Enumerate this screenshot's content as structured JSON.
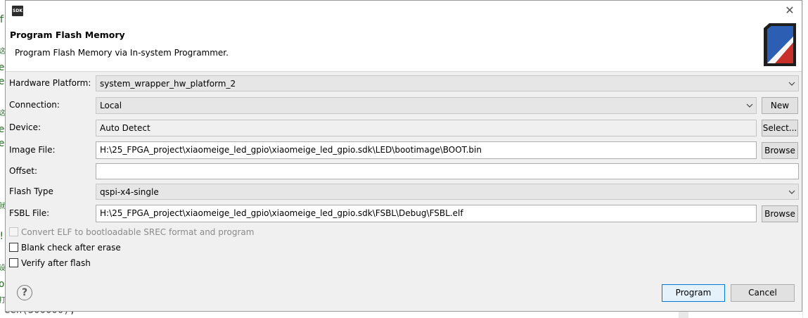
{
  "window": {
    "app_icon_text": "SDK",
    "close_glyph": "✕"
  },
  "header": {
    "title": "Program Flash Memory",
    "description": "Program Flash Memory via In-system Programmer.",
    "icon": "flash-memory-card-icon"
  },
  "form": {
    "hardware_platform": {
      "label": "Hardware Platform:",
      "value": "system_wrapper_hw_platform_2"
    },
    "connection": {
      "label": "Connection:",
      "value": "Local",
      "new_button": "New"
    },
    "device": {
      "label": "Device:",
      "value": "Auto Detect",
      "select_button": "Select..."
    },
    "image_file": {
      "label": "Image File:",
      "value": "H:\\25_FPGA_project\\xiaomeige_led_gpio\\xiaomeige_led_gpio.sdk\\LED\\bootimage\\BOOT.bin",
      "browse_button": "Browse"
    },
    "offset": {
      "label": "Offset:",
      "value": ""
    },
    "flash_type": {
      "label": "Flash Type",
      "value": "qspi-x4-single"
    },
    "fsbl_file": {
      "label": "FSBL File:",
      "value": "H:\\25_FPGA_project\\xiaomeige_led_gpio\\xiaomeige_led_gpio.sdk\\FSBL\\Debug\\FSBL.elf",
      "browse_button": "Browse"
    }
  },
  "options": {
    "convert_elf": {
      "label": "Convert ELF to bootloadable SREC format and program",
      "checked": false,
      "enabled": false
    },
    "blank_check": {
      "label": "Blank check after erase",
      "checked": false
    },
    "verify": {
      "label": "Verify after flash",
      "checked": false
    }
  },
  "footer": {
    "help_glyph": "?",
    "program_button": "Program",
    "cancel_button": "Cancel"
  },
  "background": {
    "left_gutter": [
      "f",
      "这",
      "e",
      "e",
      "这",
      "e",
      "e",
      "就",
      "!",
      "设",
      "oi",
      "打"
    ],
    "bottom_code": "een(500000);"
  },
  "colors": {
    "accent": "#0078d7",
    "dialog_bg": "#f0f0f0",
    "combo_bg": "#e6e6e6"
  }
}
